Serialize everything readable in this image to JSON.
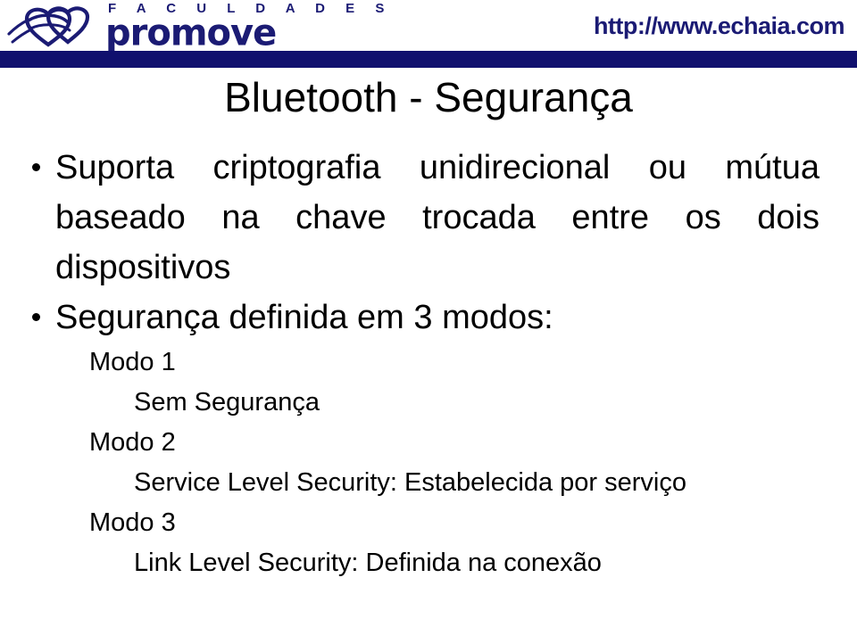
{
  "slide": {
    "title": "Bluetooth - Segurança",
    "background_color": "#ffffff",
    "text_color": "#000000"
  },
  "header": {
    "brand_color": "#1b1b74",
    "rule_color": "#10106e",
    "logo": {
      "mark_name": "promove-globe-heart-logo",
      "line1": "F A C U L D A D E S",
      "line2": "promove"
    },
    "site_url": "http://www.echaia.com"
  },
  "content": {
    "bullets": [
      {
        "text": "Suporta criptografia unidirecional ou mútua baseado na chave trocada entre os dois dispositivos",
        "justified": true
      },
      {
        "text": "Segurança definida em 3 modos:",
        "justified": false
      }
    ],
    "modes": [
      {
        "label": "Modo 1",
        "description": "Sem Segurança"
      },
      {
        "label": "Modo 2",
        "description": "Service Level Security: Estabelecida por serviço"
      },
      {
        "label": "Modo 3",
        "description": "Link Level Security: Definida na conexão"
      }
    ]
  }
}
